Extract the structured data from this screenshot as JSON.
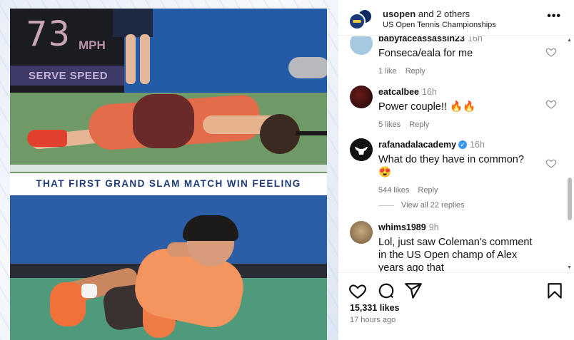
{
  "media": {
    "speed_value": "73",
    "speed_unit": "MPH",
    "serve_speed_label": "SERVE SPEED",
    "caption": "THAT FIRST GRAND SLAM MATCH WIN FEELING"
  },
  "header": {
    "username": "usopen",
    "collaborators": "and 2 others",
    "subtitle": "US Open Tennis Championships",
    "more_label": "•••"
  },
  "comments": [
    {
      "username": "babyfaceassassin23",
      "time": "16h",
      "text": "Fonseca/eala for me",
      "likes": "1 like",
      "reply": "Reply"
    },
    {
      "username": "eatcalbee",
      "time": "16h",
      "text": "Power couple!! 🔥🔥",
      "likes": "5 likes",
      "reply": "Reply"
    },
    {
      "username": "rafanadalacademy",
      "time": "16h",
      "verified": true,
      "text": "What do they have in common? 😍",
      "likes": "544 likes",
      "reply": "Reply",
      "view_replies": "View all 22 replies"
    },
    {
      "username": "whims1989",
      "time": "9h",
      "text": "Lol, just saw Coleman's comment in the US Open champ of Alex years ago that"
    }
  ],
  "footer": {
    "likes_count": "15,331 likes",
    "posted_ago": "17 hours ago"
  },
  "icons": {
    "like": "heart-icon",
    "comment": "comment-icon",
    "share": "share-icon",
    "save": "bookmark-icon"
  }
}
